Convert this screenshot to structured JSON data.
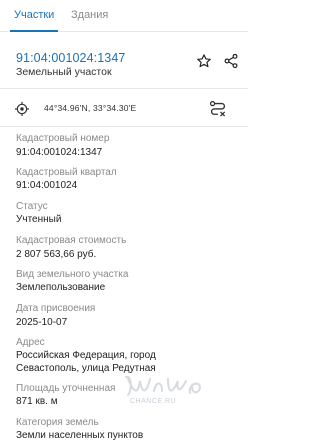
{
  "tabs": {
    "parcels_label": "Участки",
    "buildings_label": "Здания"
  },
  "header": {
    "cadastral_id": "91:04:001024:1347",
    "object_type": "Земельный участок"
  },
  "location": {
    "coordinates": "44°34.96'N, 33°34.30'E"
  },
  "fields": [
    {
      "label": "Кадастровый номер",
      "value": "91:04:001024:1347"
    },
    {
      "label": "Кадастровый квартал",
      "value": "91:04:001024"
    },
    {
      "label": "Статус",
      "value": "Учтенный"
    },
    {
      "label": "Кадастровая стоимость",
      "value": "2 807 563,66 руб."
    },
    {
      "label": "Вид земельного участка",
      "value": "Землепользование"
    },
    {
      "label": "Дата присвоения",
      "value": "2025-10-07"
    },
    {
      "label": "Адрес",
      "value_line1": "Российская Федерация, город",
      "value_line2": "Севастополь, улица Редутная"
    },
    {
      "label": "Площадь уточненная",
      "value": "871 кв. м"
    },
    {
      "label": "Категория земель",
      "value": "Земли населенных пунктов"
    }
  ],
  "watermark": {
    "text": "CHANCE.RU"
  },
  "colors": {
    "accent": "#1a73b8",
    "label_gray": "#8a8a8a",
    "text": "#1f1f1f"
  },
  "icons": {
    "star": "star-outline-icon",
    "share": "share-icon",
    "locate": "crosshair-target-icon",
    "route": "route-icon"
  }
}
